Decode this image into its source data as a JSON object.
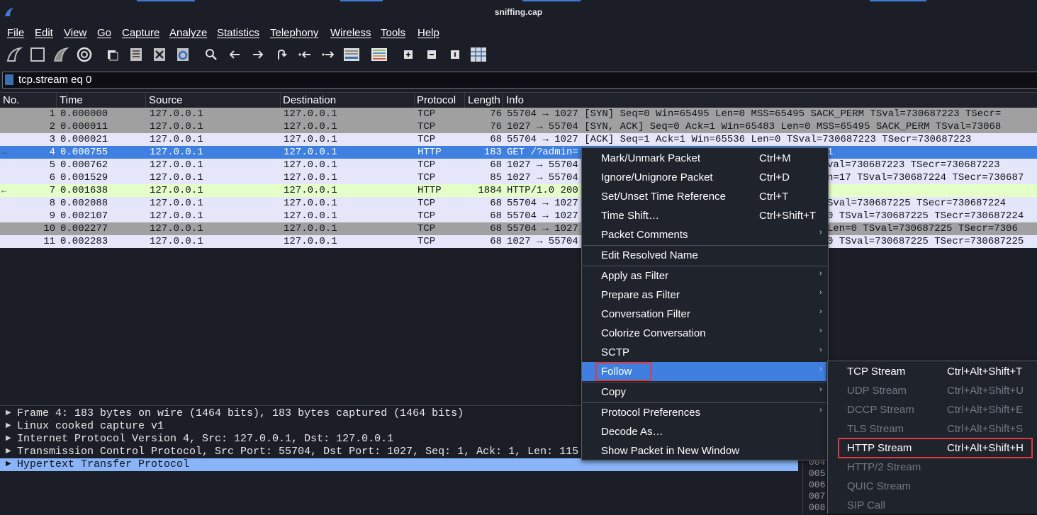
{
  "window": {
    "title": "sniffing.cap"
  },
  "menubar": [
    "File",
    "Edit",
    "View",
    "Go",
    "Capture",
    "Analyze",
    "Statistics",
    "Telephony",
    "Wireless",
    "Tools",
    "Help"
  ],
  "toolbar_icons": [
    "shark-fin-start-icon",
    "stop-square-icon",
    "shark-fin-restart-icon",
    "gear-options-icon",
    "open-file-icon",
    "save-file-icon",
    "close-file-icon",
    "reload-icon",
    "search-icon",
    "arrow-left-icon",
    "arrow-right-icon",
    "go-to-packet-icon",
    "first-packet-icon",
    "last-packet-icon",
    "auto-scroll-icon",
    "colorize-icon",
    "zoom-in-icon",
    "zoom-out-icon",
    "normal-size-icon",
    "resize-columns-icon"
  ],
  "filter": {
    "value": "tcp.stream eq 0"
  },
  "columns": [
    "No.",
    "Time",
    "Source",
    "Destination",
    "Protocol",
    "Length",
    "Info"
  ],
  "packets": [
    {
      "no": "1",
      "time": "0.000000",
      "src": "127.0.0.1",
      "dst": "127.0.0.1",
      "proto": "TCP",
      "len": "76",
      "info": "55704 → 1027 [SYN] Seq=0 Win=65495 Len=0 MSS=65495 SACK_PERM TSval=730687223 TSecr=",
      "bg": "#a0a0a0"
    },
    {
      "no": "2",
      "time": "0.000011",
      "src": "127.0.0.1",
      "dst": "127.0.0.1",
      "proto": "TCP",
      "len": "76",
      "info": "1027 → 55704 [SYN, ACK] Seq=0 Ack=1 Win=65483 Len=0 MSS=65495 SACK_PERM TSval=73068",
      "bg": "#a0a0a0"
    },
    {
      "no": "3",
      "time": "0.000021",
      "src": "127.0.0.1",
      "dst": "127.0.0.1",
      "proto": "TCP",
      "len": "68",
      "info": "55704 → 1027 [ACK] Seq=1 Ack=1 Win=65536 Len=0 TSval=730687223 TSecr=730687223",
      "bg": "#e6e6fa"
    },
    {
      "no": "4",
      "time": "0.000755",
      "src": "127.0.0.1",
      "dst": "127.0.0.1",
      "proto": "HTTP",
      "len": "183",
      "info": "GET /?admin=",
      "bg": "#3e7fe0",
      "fg": "#ffffff",
      "rel": "→"
    },
    {
      "no": "5",
      "time": "0.000762",
      "src": "127.0.0.1",
      "dst": "127.0.0.1",
      "proto": "TCP",
      "len": "68",
      "info": "1027 → 55704",
      "bg": "#e6e6fa"
    },
    {
      "no": "6",
      "time": "0.001529",
      "src": "127.0.0.1",
      "dst": "127.0.0.1",
      "proto": "TCP",
      "len": "85",
      "info": "1027 → 55704",
      "bg": "#e6e6fa"
    },
    {
      "no": "7",
      "time": "0.001638",
      "src": "127.0.0.1",
      "dst": "127.0.0.1",
      "proto": "HTTP",
      "len": "1884",
      "info": "HTTP/1.0 200",
      "bg": "#e4ffc7",
      "rel": "←"
    },
    {
      "no": "8",
      "time": "0.002088",
      "src": "127.0.0.1",
      "dst": "127.0.0.1",
      "proto": "TCP",
      "len": "68",
      "info": "55704 → 1027",
      "bg": "#e6e6fa"
    },
    {
      "no": "9",
      "time": "0.002107",
      "src": "127.0.0.1",
      "dst": "127.0.0.1",
      "proto": "TCP",
      "len": "68",
      "info": "55704 → 1027",
      "bg": "#e6e6fa"
    },
    {
      "no": "10",
      "time": "0.002277",
      "src": "127.0.0.1",
      "dst": "127.0.0.1",
      "proto": "TCP",
      "len": "68",
      "info": "55704 → 1027",
      "bg": "#a0a0a0"
    },
    {
      "no": "11",
      "time": "0.002283",
      "src": "127.0.0.1",
      "dst": "127.0.0.1",
      "proto": "TCP",
      "len": "68",
      "info": "1027 → 55704",
      "bg": "#e6e6fa"
    }
  ],
  "info_tails": [
    {
      "row": 4,
      "text": "1"
    },
    {
      "row": 5,
      "text": "val=730687223 TSecr=730687223"
    },
    {
      "row": 6,
      "text": "n=17 TSval=730687224 TSecr=730687"
    },
    {
      "row": 8,
      "text": "Sval=730687225 TSecr=730687224"
    },
    {
      "row": 9,
      "text": "0 TSval=730687225 TSecr=730687224"
    },
    {
      "row": 10,
      "text": "Len=0 TSval=730687225 TSecr=7306"
    },
    {
      "row": 11,
      "text": "0 TSval=730687225 TSecr=730687225"
    }
  ],
  "details": [
    "Frame 4: 183 bytes on wire (1464 bits), 183 bytes captured (1464 bits)",
    "Linux cooked capture v1",
    "Internet Protocol Version 4, Src: 127.0.0.1, Dst: 127.0.0.1",
    "Transmission Control Protocol, Src Port: 55704, Dst Port: 1027, Seq: 1, Ack: 1, Len: 115",
    "Hypertext Transfer Protocol"
  ],
  "hex_offsets": [
    "004",
    "005",
    "006",
    "007",
    "008"
  ],
  "context_menu": {
    "items": [
      {
        "label": "Mark/Unmark Packet",
        "shortcut": "Ctrl+M"
      },
      {
        "label": "Ignore/Unignore Packet",
        "shortcut": "Ctrl+D"
      },
      {
        "label": "Set/Unset Time Reference",
        "shortcut": "Ctrl+T"
      },
      {
        "label": "Time Shift…",
        "shortcut": "Ctrl+Shift+T"
      },
      {
        "label": "Packet Comments",
        "shortcut": "",
        "submenu": true
      },
      {
        "sep": true
      },
      {
        "label": "Edit Resolved Name",
        "shortcut": ""
      },
      {
        "sep": true
      },
      {
        "label": "Apply as Filter",
        "shortcut": "",
        "submenu": true
      },
      {
        "label": "Prepare as Filter",
        "shortcut": "",
        "submenu": true
      },
      {
        "label": "Conversation Filter",
        "shortcut": "",
        "submenu": true
      },
      {
        "label": "Colorize Conversation",
        "shortcut": "",
        "submenu": true
      },
      {
        "label": "SCTP",
        "shortcut": "",
        "submenu": true
      },
      {
        "label": "Follow",
        "shortcut": "",
        "submenu": true,
        "highlight": true
      },
      {
        "sep": true
      },
      {
        "label": "Copy",
        "shortcut": "",
        "submenu": true
      },
      {
        "sep": true
      },
      {
        "label": "Protocol Preferences",
        "shortcut": "",
        "submenu": true
      },
      {
        "label": "Decode As…",
        "shortcut": ""
      },
      {
        "label": "Show Packet in New Window",
        "shortcut": ""
      }
    ]
  },
  "follow_submenu": {
    "items": [
      {
        "label": "TCP Stream",
        "shortcut": "Ctrl+Alt+Shift+T",
        "enabled": true
      },
      {
        "label": "UDP Stream",
        "shortcut": "Ctrl+Alt+Shift+U",
        "enabled": false
      },
      {
        "label": "DCCP Stream",
        "shortcut": "Ctrl+Alt+Shift+E",
        "enabled": false
      },
      {
        "label": "TLS Stream",
        "shortcut": "Ctrl+Alt+Shift+S",
        "enabled": false
      },
      {
        "label": "HTTP Stream",
        "shortcut": "Ctrl+Alt+Shift+H",
        "enabled": true,
        "boxed": true
      },
      {
        "label": "HTTP/2 Stream",
        "shortcut": "",
        "enabled": false
      },
      {
        "label": "QUIC Stream",
        "shortcut": "",
        "enabled": false
      },
      {
        "label": "SIP Call",
        "shortcut": "",
        "enabled": false
      }
    ]
  },
  "colors": {
    "selection": "#3e7fe0",
    "annotation": "#e0393e",
    "tcp_row": "#e6e6fa",
    "http_row": "#e4ffc7",
    "tcp_flag_row": "#a0a0a0"
  }
}
